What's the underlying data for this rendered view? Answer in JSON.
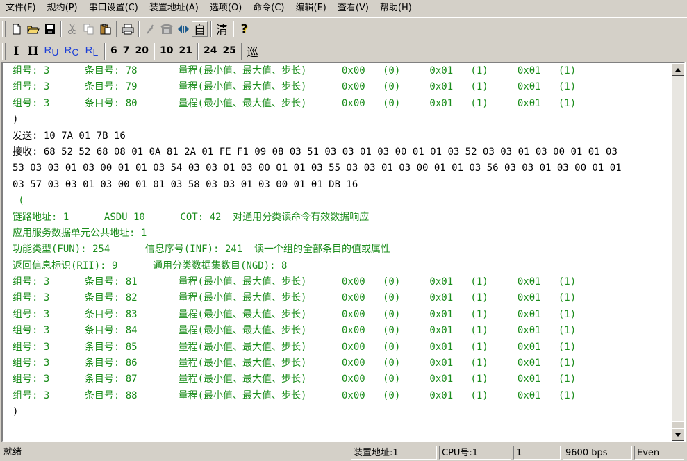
{
  "menu": [
    "文件(F)",
    "规约(P)",
    "串口设置(C)",
    "装置地址(A)",
    "选项(O)",
    "命令(C)",
    "编辑(E)",
    "查看(V)",
    "帮助(H)"
  ],
  "toolbar1": {
    "icons": [
      "new-file-icon",
      "open-folder-icon",
      "save-icon",
      "cut-icon",
      "copy-icon",
      "paste-icon",
      "print-icon",
      "disconnect-icon",
      "phone-icon",
      "connect-icon"
    ],
    "auto_label": "自",
    "clear_label": "清",
    "help_label": "?"
  },
  "toolbar2": {
    "roman1": "I",
    "roman2": "II",
    "ru": {
      "r": "R",
      "s": "U"
    },
    "rc": {
      "r": "R",
      "s": "C"
    },
    "rl": {
      "r": "R",
      "s": "L"
    },
    "nums": [
      "6",
      "7",
      "20",
      "10",
      "21",
      "24",
      "25"
    ],
    "last_label": "巡"
  },
  "log": [
    {
      "text": "组号: 3      条目号: 78       量程(最小值、最大值、步长)      0x00   (0)     0x01   (1)     0x01   (1)",
      "color": "green"
    },
    {
      "text": "组号: 3      条目号: 79       量程(最小值、最大值、步长)      0x00   (0)     0x01   (1)     0x01   (1)",
      "color": "green"
    },
    {
      "text": "组号: 3      条目号: 80       量程(最小值、最大值、步长)      0x00   (0)     0x01   (1)     0x01   (1)",
      "color": "green"
    },
    {
      "text": ")",
      "color": "black"
    },
    {
      "text": "发送: 10 7A 01 7B 16",
      "color": "black"
    },
    {
      "text": "接收: 68 52 52 68 08 01 0A 81 2A 01 FE F1 09 08 03 51 03 03 01 03 00 01 01 03 52 03 03 01 03 00 01 01 03",
      "color": "black"
    },
    {
      "text": "53 03 03 01 03 00 01 01 03 54 03 03 01 03 00 01 01 03 55 03 03 01 03 00 01 01 03 56 03 03 01 03 00 01 01",
      "color": "black"
    },
    {
      "text": "03 57 03 03 01 03 00 01 01 03 58 03 03 01 03 00 01 01 DB 16",
      "color": "black"
    },
    {
      "text": " (",
      "color": "green"
    },
    {
      "text": "链路地址: 1      ASDU 10      COT: 42  对通用分类读命令有效数据响应",
      "color": "green"
    },
    {
      "text": "应用服务数据单元公共地址: 1",
      "color": "green"
    },
    {
      "text": "功能类型(FUN): 254      信息序号(INF): 241  读一个组的全部条目的值或属性",
      "color": "green"
    },
    {
      "text": "返回信息标识(RII): 9      通用分类数据集数目(NGD): 8",
      "color": "green"
    },
    {
      "text": "组号: 3      条目号: 81       量程(最小值、最大值、步长)      0x00   (0)     0x01   (1)     0x01   (1)",
      "color": "green"
    },
    {
      "text": "组号: 3      条目号: 82       量程(最小值、最大值、步长)      0x00   (0)     0x01   (1)     0x01   (1)",
      "color": "green"
    },
    {
      "text": "组号: 3      条目号: 83       量程(最小值、最大值、步长)      0x00   (0)     0x01   (1)     0x01   (1)",
      "color": "green"
    },
    {
      "text": "组号: 3      条目号: 84       量程(最小值、最大值、步长)      0x00   (0)     0x01   (1)     0x01   (1)",
      "color": "green"
    },
    {
      "text": "组号: 3      条目号: 85       量程(最小值、最大值、步长)      0x00   (0)     0x01   (1)     0x01   (1)",
      "color": "green"
    },
    {
      "text": "组号: 3      条目号: 86       量程(最小值、最大值、步长)      0x00   (0)     0x01   (1)     0x01   (1)",
      "color": "green"
    },
    {
      "text": "组号: 3      条目号: 87       量程(最小值、最大值、步长)      0x00   (0)     0x01   (1)     0x01   (1)",
      "color": "green"
    },
    {
      "text": "组号: 3      条目号: 88       量程(最小值、最大值、步长)      0x00   (0)     0x01   (1)     0x01   (1)",
      "color": "green"
    },
    {
      "text": ")",
      "color": "black"
    }
  ],
  "status": {
    "ready": "就绪",
    "device_address": "装置地址:1",
    "cpu": "CPU号:1",
    "value": "1",
    "baud": "9600 bps",
    "parity": "Even"
  },
  "colors": {
    "log_green": "#1a8c1a",
    "ru_blue": "#1c3fd6"
  }
}
